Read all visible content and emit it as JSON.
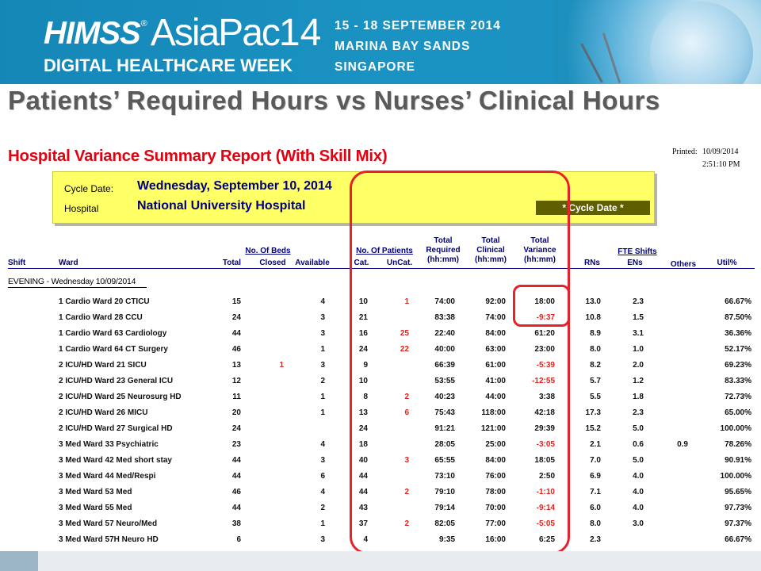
{
  "banner": {
    "logo_brand": "HIMSS",
    "logo_reg": "®",
    "logo_event": "AsiaPac",
    "logo_year": "14",
    "tagline": "DIGITAL HEALTHCARE WEEK",
    "dates": "15 - 18 SEPTEMBER 2014",
    "venue": "MARINA BAY SANDS",
    "city": "SINGAPORE"
  },
  "slide_title": "Patients’ Required Hours vs Nurses’ Clinical Hours",
  "report": {
    "title": "Hospital Variance Summary Report (With Skill Mix)",
    "printed_label": "Printed:",
    "printed_date": "10/09/2014",
    "printed_time": "2:51:10 PM",
    "cycle_label": "Cycle Date:",
    "cycle_value": "Wednesday, September 10, 2014",
    "hospital_label": "Hospital",
    "hospital_value": "National University Hospital",
    "cycle_badge": "* Cycle Date *"
  },
  "headers": {
    "shift": "Shift",
    "ward": "Ward",
    "beds_group": "No. Of Beds",
    "beds_total": "Total",
    "beds_closed": "Closed",
    "beds_available": "Available",
    "patients_group": "No. Of Patients",
    "patients_cat": "Cat.",
    "patients_uncat": "UnCat.",
    "required_1": "Total",
    "required_2": "Required",
    "required_3": "(hh:mm)",
    "clinical_1": "Total",
    "clinical_2": "Clinical",
    "clinical_3": "(hh:mm)",
    "variance_1": "Total",
    "variance_2": "Variance",
    "variance_3": "(hh:mm)",
    "rns": "RNs",
    "fte_group": "FTE Shifts",
    "ens": "ENs",
    "others": "Others",
    "util": "Util%"
  },
  "section_label": "EVENING - Wednesday 10/09/2014",
  "rows": [
    {
      "ward": "1 Cardio Ward 20 CTICU",
      "total": "15",
      "closed": "",
      "available": "4",
      "cat": "10",
      "uncat": "1",
      "required": "74:00",
      "clinical": "92:00",
      "variance": "18:00",
      "variance_neg": false,
      "rns": "13.0",
      "ens": "2.3",
      "others": "",
      "util": "66.67%"
    },
    {
      "ward": "1 Cardio Ward 28 CCU",
      "total": "24",
      "closed": "",
      "available": "3",
      "cat": "21",
      "uncat": "",
      "required": "83:38",
      "clinical": "74:00",
      "variance": "-9:37",
      "variance_neg": true,
      "rns": "10.8",
      "ens": "1.5",
      "others": "",
      "util": "87.50%"
    },
    {
      "ward": "1 Cardio Ward 63 Cardiology",
      "total": "44",
      "closed": "",
      "available": "3",
      "cat": "16",
      "uncat": "25",
      "required": "22:40",
      "clinical": "84:00",
      "variance": "61:20",
      "variance_neg": false,
      "rns": "8.9",
      "ens": "3.1",
      "others": "",
      "util": "36.36%"
    },
    {
      "ward": "1 Cardio Ward 64 CT Surgery",
      "total": "46",
      "closed": "",
      "available": "1",
      "cat": "24",
      "uncat": "22",
      "required": "40:00",
      "clinical": "63:00",
      "variance": "23:00",
      "variance_neg": false,
      "rns": "8.0",
      "ens": "1.0",
      "others": "",
      "util": "52.17%"
    },
    {
      "ward": "2 ICU/HD Ward 21 SICU",
      "total": "13",
      "closed": "1",
      "available": "3",
      "cat": "9",
      "uncat": "",
      "required": "66:39",
      "clinical": "61:00",
      "variance": "-5:39",
      "variance_neg": true,
      "rns": "8.2",
      "ens": "2.0",
      "others": "",
      "util": "69.23%"
    },
    {
      "ward": "2 ICU/HD Ward 23 General ICU",
      "total": "12",
      "closed": "",
      "available": "2",
      "cat": "10",
      "uncat": "",
      "required": "53:55",
      "clinical": "41:00",
      "variance": "-12:55",
      "variance_neg": true,
      "rns": "5.7",
      "ens": "1.2",
      "others": "",
      "util": "83.33%"
    },
    {
      "ward": "2 ICU/HD Ward 25 Neurosurg HD",
      "total": "11",
      "closed": "",
      "available": "1",
      "cat": "8",
      "uncat": "2",
      "required": "40:23",
      "clinical": "44:00",
      "variance": "3:38",
      "variance_neg": false,
      "rns": "5.5",
      "ens": "1.8",
      "others": "",
      "util": "72.73%"
    },
    {
      "ward": "2 ICU/HD Ward 26 MICU",
      "total": "20",
      "closed": "",
      "available": "1",
      "cat": "13",
      "uncat": "6",
      "required": "75:43",
      "clinical": "118:00",
      "variance": "42:18",
      "variance_neg": false,
      "rns": "17.3",
      "ens": "2.3",
      "others": "",
      "util": "65.00%"
    },
    {
      "ward": "2 ICU/HD Ward 27 Surgical HD",
      "total": "24",
      "closed": "",
      "available": "",
      "cat": "24",
      "uncat": "",
      "required": "91:21",
      "clinical": "121:00",
      "variance": "29:39",
      "variance_neg": false,
      "rns": "15.2",
      "ens": "5.0",
      "others": "",
      "util": "100.00%"
    },
    {
      "ward": "3 Med Ward 33 Psychiatric",
      "total": "23",
      "closed": "",
      "available": "4",
      "cat": "18",
      "uncat": "",
      "required": "28:05",
      "clinical": "25:00",
      "variance": "-3:05",
      "variance_neg": true,
      "rns": "2.1",
      "ens": "0.6",
      "others": "0.9",
      "util": "78.26%"
    },
    {
      "ward": "3 Med Ward 42 Med short stay",
      "total": "44",
      "closed": "",
      "available": "3",
      "cat": "40",
      "uncat": "3",
      "required": "65:55",
      "clinical": "84:00",
      "variance": "18:05",
      "variance_neg": false,
      "rns": "7.0",
      "ens": "5.0",
      "others": "",
      "util": "90.91%"
    },
    {
      "ward": "3 Med Ward 44 Med/Respi",
      "total": "44",
      "closed": "",
      "available": "6",
      "cat": "44",
      "uncat": "",
      "required": "73:10",
      "clinical": "76:00",
      "variance": "2:50",
      "variance_neg": false,
      "rns": "6.9",
      "ens": "4.0",
      "others": "",
      "util": "100.00%"
    },
    {
      "ward": "3 Med Ward 53 Med",
      "total": "46",
      "closed": "",
      "available": "4",
      "cat": "44",
      "uncat": "2",
      "required": "79:10",
      "clinical": "78:00",
      "variance": "-1:10",
      "variance_neg": true,
      "rns": "7.1",
      "ens": "4.0",
      "others": "",
      "util": "95.65%"
    },
    {
      "ward": "3 Med Ward 55 Med",
      "total": "44",
      "closed": "",
      "available": "2",
      "cat": "43",
      "uncat": "",
      "required": "79:14",
      "clinical": "70:00",
      "variance": "-9:14",
      "variance_neg": true,
      "rns": "6.0",
      "ens": "4.0",
      "others": "",
      "util": "97.73%"
    },
    {
      "ward": "3 Med Ward 57 Neuro/Med",
      "total": "38",
      "closed": "",
      "available": "1",
      "cat": "37",
      "uncat": "2",
      "required": "82:05",
      "clinical": "77:00",
      "variance": "-5:05",
      "variance_neg": true,
      "rns": "8.0",
      "ens": "3.0",
      "others": "",
      "util": "97.37%"
    },
    {
      "ward": "3 Med Ward 57H Neuro HD",
      "total": "6",
      "closed": "",
      "available": "3",
      "cat": "4",
      "uncat": "",
      "required": "9:35",
      "clinical": "16:00",
      "variance": "6:25",
      "variance_neg": false,
      "rns": "2.3",
      "ens": "",
      "others": "",
      "util": "66.67%"
    }
  ],
  "colors": {
    "banner": "#1a93c3",
    "report_title": "#e4000f",
    "info_box": "#ffff66",
    "header_text": "#000080",
    "highlight_oval": "#e8202a",
    "negative_value": "#e8201a"
  }
}
